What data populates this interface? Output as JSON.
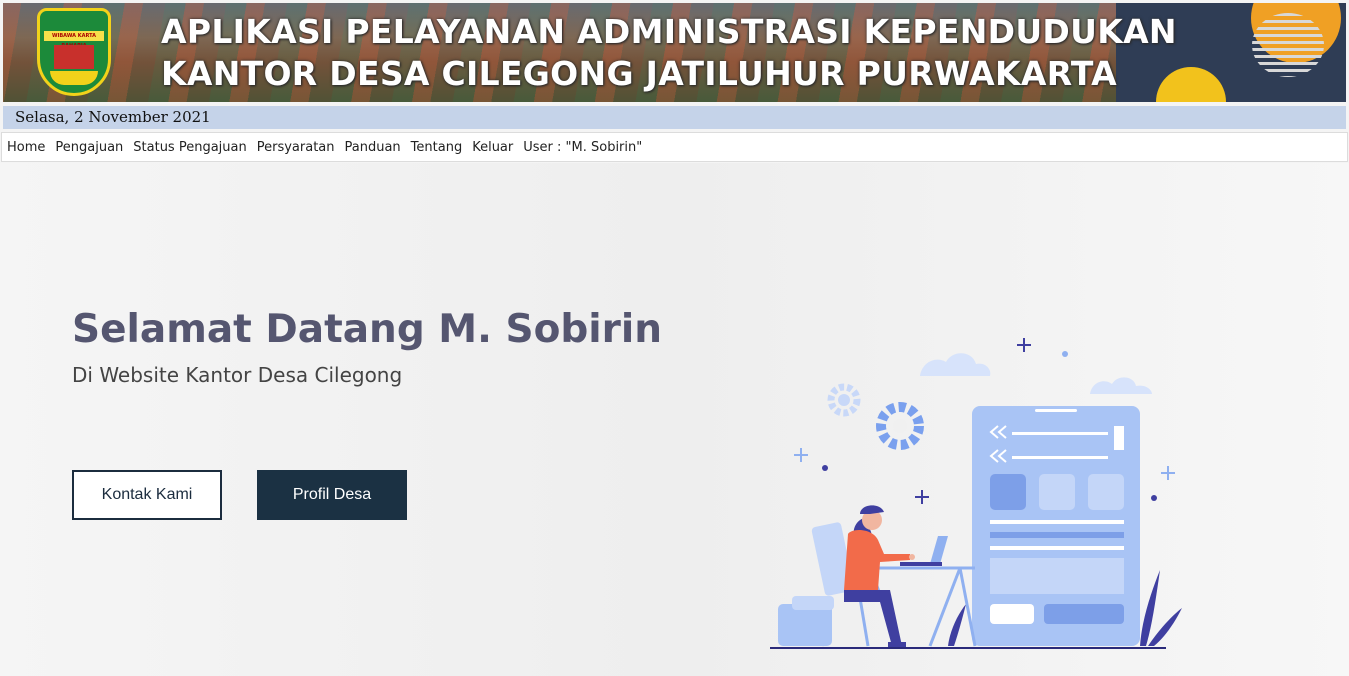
{
  "banner": {
    "line1": "APLIKASI PELAYANAN ADMINISTRASI KEPENDUDUKAN",
    "line2": "KANTOR DESA CILEGONG JATILUHUR PURWAKARTA",
    "emblem_ribbon": "WIBAWA KARTA RAHARJA"
  },
  "date": "Selasa, 2 November 2021",
  "nav": {
    "home": "Home",
    "pengajuan": "Pengajuan",
    "status": "Status Pengajuan",
    "persyaratan": "Persyaratan",
    "panduan": "Panduan",
    "tentang": "Tentang",
    "keluar": "Keluar",
    "user": "User : \"M. Sobirin\""
  },
  "hero": {
    "title": "Selamat Datang M. Sobirin",
    "subtitle": "Di Website Kantor Desa Cilegong",
    "btn_contact": "Kontak Kami",
    "btn_profile": "Profil Desa"
  },
  "colors": {
    "accent_dark": "#1b3143",
    "date_bar": "#c5d3e9",
    "illustration_blue": "#a9c4f5",
    "illustration_navy": "#3f3fa0"
  }
}
